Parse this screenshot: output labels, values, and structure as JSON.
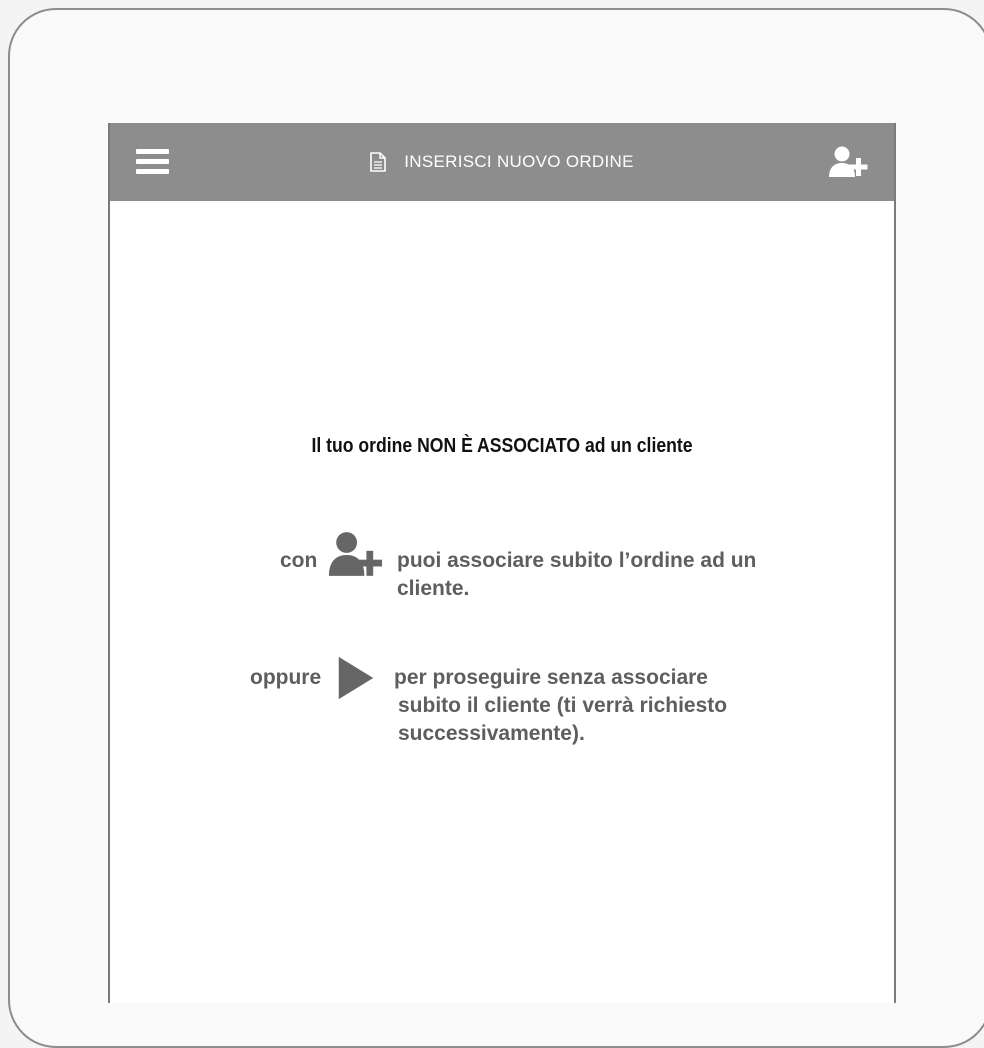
{
  "header": {
    "title": "INSERISCI NUOVO ORDINE",
    "menu_icon": "hamburger-menu-icon",
    "document_icon": "document-icon",
    "add_customer_icon": "add-user-icon",
    "background_color": "#8d8d8d"
  },
  "main": {
    "headline": "Il tuo ordine NON È ASSOCIATO ad un cliente",
    "option_associate": {
      "prefix": "con",
      "icon": "add-user-icon",
      "text_line1": "puoi associare subito l’ordine ad un",
      "text_line2": "cliente."
    },
    "option_continue": {
      "prefix": "oppure",
      "icon": "play-icon",
      "text_line1": "per proseguire senza associare",
      "text_line2": "subito il cliente (ti verrà richiesto",
      "text_line3": "successivamente)."
    }
  }
}
